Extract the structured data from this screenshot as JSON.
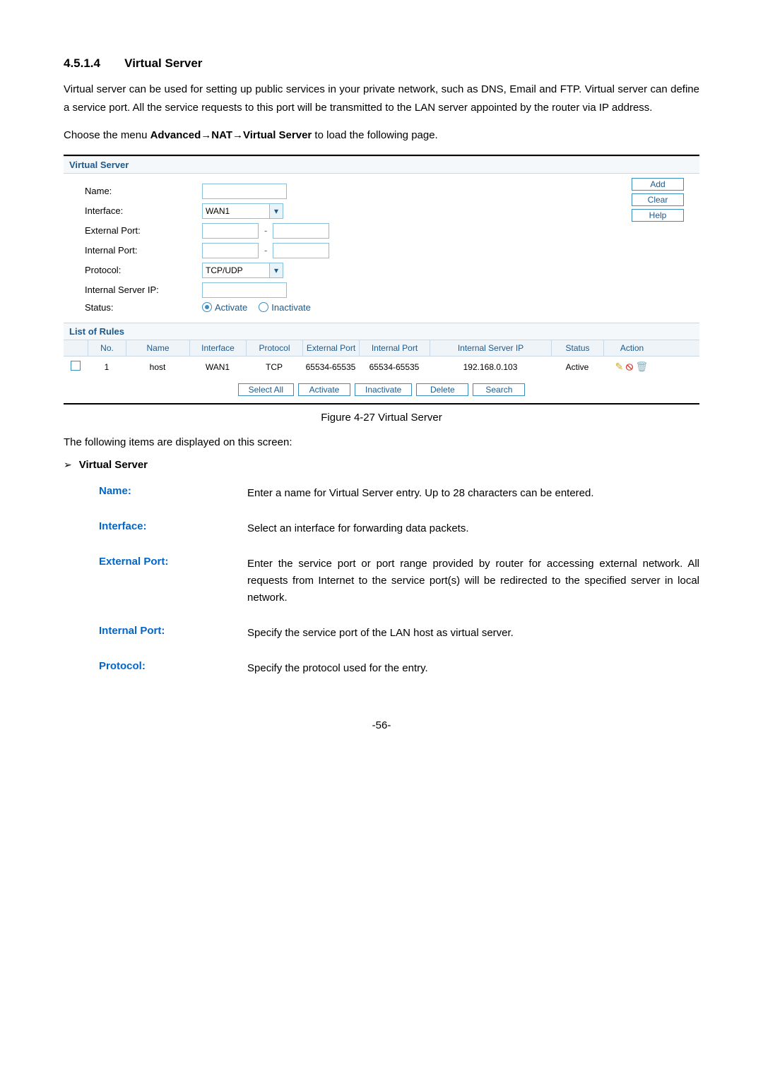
{
  "section": {
    "number": "4.5.1.4",
    "title": "Virtual Server"
  },
  "intro1": "Virtual server can be used for setting up public services in your private network, such as DNS, Email and FTP. Virtual server can define a service port. All the service requests to this port will be transmitted to the LAN server appointed by the router via IP address.",
  "intro2_prefix": "Choose the menu ",
  "intro2_bold": "Advanced→NAT→Virtual Server",
  "intro2_suffix": " to load the following page.",
  "screenshot": {
    "header1": "Virtual Server",
    "labels": {
      "name": "Name:",
      "interface": "Interface:",
      "external_port": "External Port:",
      "internal_port": "Internal Port:",
      "protocol": "Protocol:",
      "internal_server_ip": "Internal Server IP:",
      "status": "Status:"
    },
    "values": {
      "interface": "WAN1",
      "protocol": "TCP/UDP",
      "status_activate": "Activate",
      "status_inactivate": "Inactivate"
    },
    "buttons": {
      "add": "Add",
      "clear": "Clear",
      "help": "Help",
      "select_all": "Select All",
      "activate": "Activate",
      "inactivate": "Inactivate",
      "delete": "Delete",
      "search": "Search"
    },
    "header2": "List of Rules",
    "headers": {
      "no": "No.",
      "name": "Name",
      "interface": "Interface",
      "protocol": "Protocol",
      "external_port": "External Port",
      "internal_port": "Internal Port",
      "internal_server_ip": "Internal Server IP",
      "status": "Status",
      "action": "Action"
    },
    "row1": {
      "no": "1",
      "name": "host",
      "interface": "WAN1",
      "protocol": "TCP",
      "external_port": "65534-65535",
      "internal_port": "65534-65535",
      "internal_server_ip": "192.168.0.103",
      "status": "Active"
    }
  },
  "caption": "Figure 4-27 Virtual Server",
  "screen_items_text": "The following items are displayed on this screen:",
  "bullet_title": "Virtual Server",
  "defs": {
    "name_term": "Name:",
    "name_desc": "Enter a name for Virtual Server entry. Up to 28 characters can be entered.",
    "interface_term": "Interface:",
    "interface_desc": "Select an interface for forwarding data packets.",
    "external_port_term": "External Port:",
    "external_port_desc": "Enter the service port or port range provided by router for accessing external network. All requests from Internet to the service port(s) will be redirected to the specified server in local network.",
    "internal_port_term": "Internal Port:",
    "internal_port_desc": "Specify the service port of the LAN host as virtual server.",
    "protocol_term": "Protocol:",
    "protocol_desc": "Specify the protocol used for the entry."
  },
  "page_number": "-56-",
  "chart_data": {
    "type": "table",
    "title": "List of Rules",
    "columns": [
      "No.",
      "Name",
      "Interface",
      "Protocol",
      "External Port",
      "Internal Port",
      "Internal Server IP",
      "Status",
      "Action"
    ],
    "rows": [
      [
        "1",
        "host",
        "WAN1",
        "TCP",
        "65534-65535",
        "65534-65535",
        "192.168.0.103",
        "Active",
        "edit/delete/trash"
      ]
    ]
  }
}
